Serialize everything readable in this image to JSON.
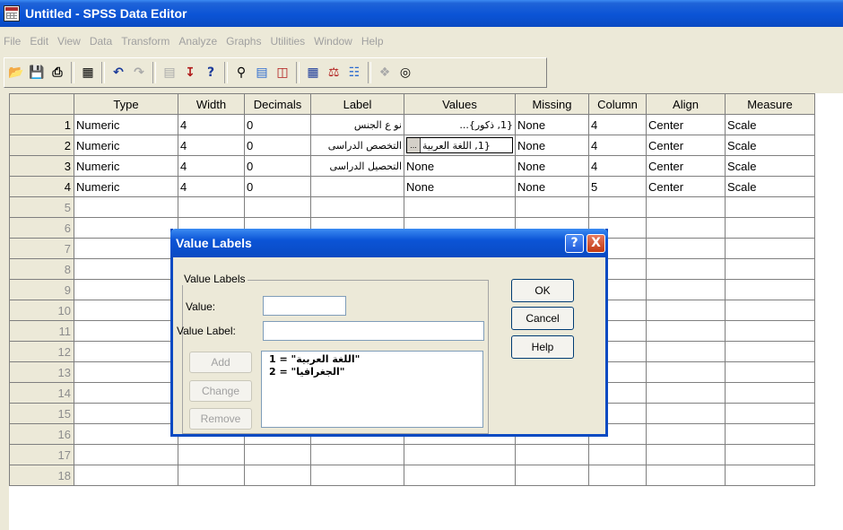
{
  "window": {
    "title": "Untitled - SPSS Data Editor",
    "icon": "data-editor-icon"
  },
  "menu": [
    "File",
    "Edit",
    "View",
    "Data",
    "Transform",
    "Analyze",
    "Graphs",
    "Utilities",
    "Window",
    "Help"
  ],
  "toolbar": {
    "icons": [
      "open-icon",
      "save-icon",
      "print-icon",
      "dialog-recall-icon",
      "undo-icon",
      "redo-icon",
      "goto-chart-icon",
      "goto-case-icon",
      "variables-icon",
      "find-icon",
      "insert-case-icon",
      "insert-variable-icon",
      "split-file-icon",
      "weight-cases-icon",
      "select-cases-icon",
      "value-labels-icon",
      "use-sets-icon"
    ]
  },
  "grid": {
    "columns": [
      "Type",
      "Width",
      "Decimals",
      "Label",
      "Values",
      "Missing",
      "Column",
      "Align",
      "Measure"
    ],
    "rows": [
      {
        "num": "1",
        "type": "Numeric",
        "width": "4",
        "decimals": "0",
        "label": "نو ع الجنس",
        "values": "{1, ذكور}...",
        "missing": "None",
        "column": "4",
        "align": "Center",
        "measure": "Scale"
      },
      {
        "num": "2",
        "type": "Numeric",
        "width": "4",
        "decimals": "0",
        "label": "التخصص الدراسى",
        "values": "{1, اللغة العربية",
        "missing": "None",
        "column": "4",
        "align": "Center",
        "measure": "Scale"
      },
      {
        "num": "3",
        "type": "Numeric",
        "width": "4",
        "decimals": "0",
        "label": "التحصيل الدراسى",
        "values": "None",
        "missing": "None",
        "column": "4",
        "align": "Center",
        "measure": "Scale"
      },
      {
        "num": "4",
        "type": "Numeric",
        "width": "4",
        "decimals": "0",
        "label": "",
        "values": "None",
        "missing": "None",
        "column": "5",
        "align": "Center",
        "measure": "Scale"
      }
    ],
    "empty_rows": [
      "5",
      "6",
      "7",
      "8",
      "9",
      "10",
      "11",
      "12",
      "13",
      "14",
      "15",
      "16",
      "17",
      "18"
    ],
    "values_button": "..."
  },
  "dialog": {
    "title": "Value Labels",
    "help_button": "?",
    "close_button": "X",
    "group_label": "Value Labels",
    "value_label": "Value:",
    "value_label_label": "Value Label:",
    "value": "",
    "value_label_value": "",
    "buttons": {
      "ok": "OK",
      "cancel": "Cancel",
      "help": "Help",
      "add": "Add",
      "change": "Change",
      "remove": "Remove"
    },
    "list": [
      "1 = \"اللغة العربية\"",
      "2 = \"الجغرافيا\""
    ]
  }
}
